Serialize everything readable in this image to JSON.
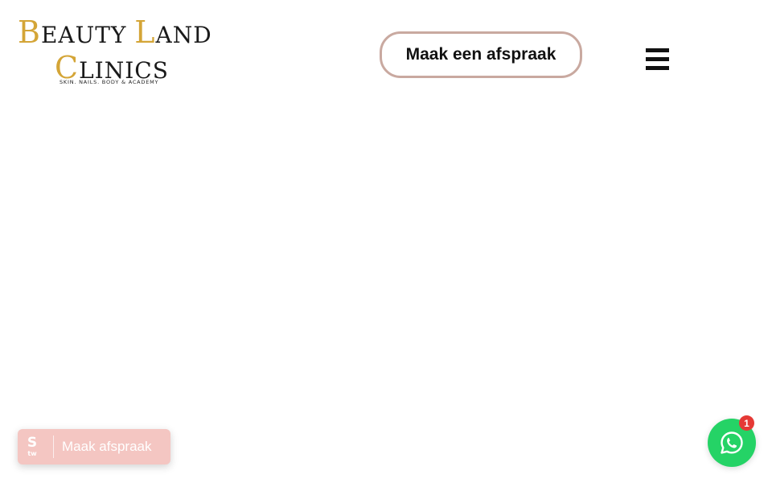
{
  "header": {
    "logo": {
      "line1_initial": "B",
      "line1_rest": "EAUTY ",
      "line1_initial2": "L",
      "line1_rest2": "AND",
      "line2_initial": "C",
      "line2_rest": "LINICS",
      "tagline": "SKIN. NAILS. BODY & ACADEMY"
    },
    "cta_label": "Maak een afspraak",
    "menu_icon": "hamburger-menu-icon"
  },
  "booking_widget": {
    "icon_letter": "S",
    "icon_sub": "tw",
    "label": "Maak afspraak",
    "color": "#f4c6c2"
  },
  "whatsapp": {
    "icon": "whatsapp-icon",
    "badge_count": "1",
    "color": "#25d366",
    "badge_color": "#e53935"
  },
  "colors": {
    "accent_gold": "#d4a537",
    "cta_border": "#c9a9a0"
  }
}
